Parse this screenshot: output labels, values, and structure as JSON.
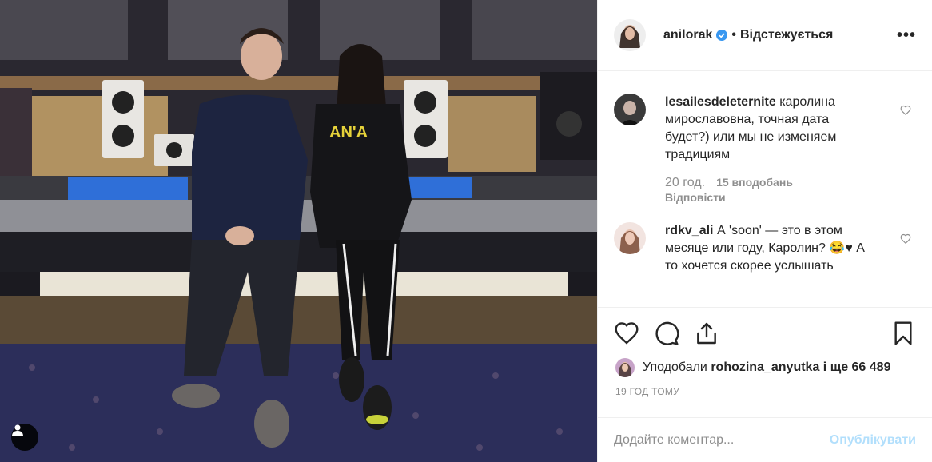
{
  "header": {
    "username": "anilorak",
    "separator": "•",
    "follow_status": "Відстежується",
    "more": "•••"
  },
  "comments": [
    {
      "username": "lesailesdeleternite",
      "text": "каролина мирославовна, точная дата будет?) или мы не изменяем традициям",
      "age": "20 год.",
      "likes": "15 вподобань",
      "reply": "Відповісти"
    },
    {
      "username": "rdkv_ali",
      "text": "А 'soon' — это в этом месяце или году, Каролин? 😂♥ А то хочется скорее услышать"
    }
  ],
  "likes": {
    "prefix": "Уподобали",
    "user": "rohozina_anyutka",
    "suffix": "і ще 66 489"
  },
  "timestamp": "19 ГОД ТОМУ",
  "add_comment": {
    "placeholder": "Додайте коментар...",
    "publish": "Опублікувати"
  },
  "photo_shirt_text": "AN'A",
  "colors": {
    "verified": "#3897f0",
    "publish_disabled": "#b2dffc",
    "secondary": "#8e8e8e"
  },
  "icons": [
    "tag-person-icon",
    "verified-badge-icon",
    "heart-icon",
    "comment-icon",
    "share-icon",
    "bookmark-icon",
    "heart-small-icon"
  ]
}
